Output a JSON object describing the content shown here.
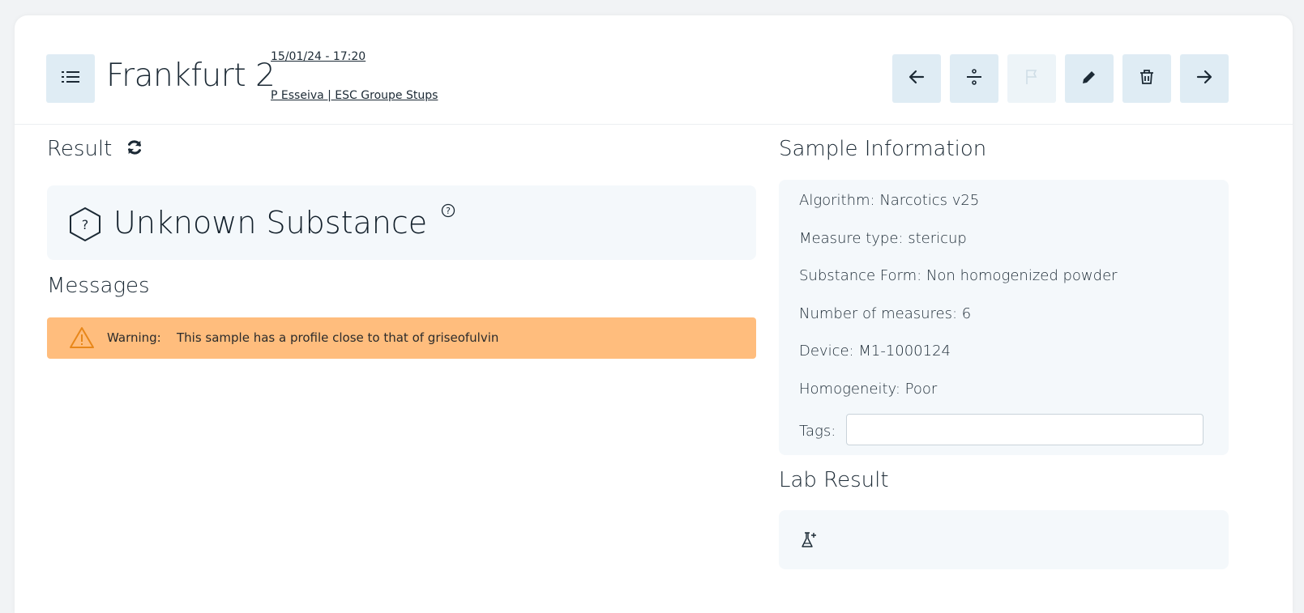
{
  "header": {
    "title": "Frankfurt 2",
    "date": "15/01/24 - 17:20",
    "user": "P Esseiva | ESC Groupe Stups",
    "buttons": [
      {
        "name": "previous",
        "icon": "arrow-left-icon",
        "disabled": false
      },
      {
        "name": "divide",
        "icon": "divide-icon",
        "disabled": false
      },
      {
        "name": "flag",
        "icon": "flag-icon",
        "disabled": true
      },
      {
        "name": "edit",
        "icon": "pencil-icon",
        "disabled": false
      },
      {
        "name": "delete",
        "icon": "trash-icon",
        "disabled": false
      },
      {
        "name": "next",
        "icon": "arrow-right-icon",
        "disabled": false
      }
    ]
  },
  "result": {
    "heading": "Result",
    "substance": "Unknown Substance"
  },
  "messages": {
    "heading": "Messages",
    "warning_label": "Warning:",
    "warning_text": "This sample has a profile close to that of griseofulvin",
    "color": "#ffbd7d"
  },
  "sample_info": {
    "heading": "Sample Information",
    "algorithm": "Algorithm: Narcotics v25",
    "measure_type": "Measure type: stericup",
    "substance_form": "Substance Form: Non homogenized powder",
    "number_of_measures": "Number of measures: 6",
    "device": "Device: M1-1000124",
    "homogeneity": "Homogeneity: Poor",
    "tags_label": "Tags:",
    "tags_value": ""
  },
  "lab_result": {
    "heading": "Lab Result"
  },
  "colors": {
    "button_bg": "#dfecf4",
    "panel_bg": "#f4f8fb",
    "text": "#1c2a35"
  }
}
